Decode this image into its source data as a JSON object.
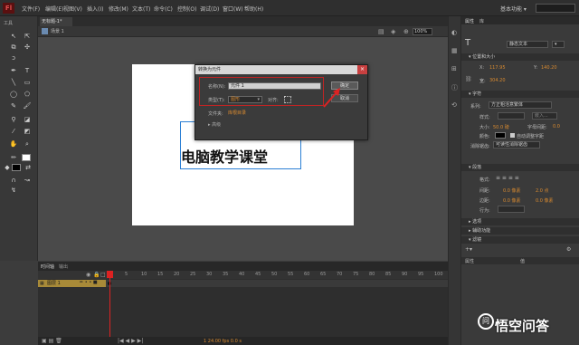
{
  "app": {
    "logo": "Fl"
  },
  "menu": [
    "文件(F)",
    "编辑(E)",
    "视图(V)",
    "插入(I)",
    "修改(M)",
    "文本(T)",
    "命令(C)",
    "控制(O)",
    "调试(D)",
    "窗口(W)",
    "帮助(H)"
  ],
  "workspace": {
    "label": "基本功能 ▾"
  },
  "document": {
    "tab": "无标题-1*",
    "close": "×",
    "scene": "场景 1",
    "zoom": "100%"
  },
  "tools": {
    "title": "工具"
  },
  "stage": {
    "text": "电脑教学课堂",
    "text_color": "#111111",
    "stage_color": "#ffffff"
  },
  "dialog": {
    "title": "转换为元件",
    "close": "×",
    "name_label": "名称(N):",
    "name_value": "元件 1",
    "type_label": "类型(T):",
    "type_value": "图形",
    "align_label": "对齐:",
    "folder_label": "文件夹:",
    "folder_value": "库根目录",
    "ok": "确定",
    "cancel": "取消",
    "advanced": "▸ 高级"
  },
  "timeline": {
    "tabs": [
      "时间轴",
      "输出"
    ],
    "frame_numbers": [
      "1",
      "5",
      "10",
      "15",
      "20",
      "25",
      "30",
      "35",
      "40",
      "45",
      "50",
      "55",
      "60",
      "65",
      "70",
      "75",
      "80",
      "85",
      "90",
      "95",
      "100"
    ],
    "layer_name": "图层 1",
    "footer": "1   24.00 fps   0.0 s"
  },
  "properties": {
    "tabs": [
      "属性",
      "库"
    ],
    "text_type": "静态文本",
    "text_orient": "▾",
    "position_section": "▾ 位置和大小",
    "x_label": "X:",
    "x_value": "117.95",
    "y_label": "Y:",
    "y_value": "140.20",
    "w_label": "宽:",
    "w_value": "304.20",
    "char_section": "▾ 字符",
    "family_label": "系列:",
    "family_value": "方正粗活意繁体",
    "style_label": "样式:",
    "embed": "嵌入...",
    "size_label": "大小:",
    "size_value": "50.0 磅",
    "spacing_label": "字母间距:",
    "spacing_value": "0.0",
    "color_label": "颜色:",
    "autokern": "自动调整字距",
    "aa_label": "消除锯齿:",
    "aa_value": "可读性消除锯齿",
    "para_section": "▾ 段落",
    "format_label": "格式:",
    "gap_label": "间距:",
    "gap_value1": "0.0 像素",
    "gap_value2": "2.0 点",
    "margin_label": "边距:",
    "margin_value1": "0.0 像素",
    "margin_value2": "0.0 像素",
    "behavior_label": "行为:",
    "options_section": "▸ 选项",
    "a11y_section": "▸ 辅助功能",
    "filter_section": "▾ 滤镜",
    "prop_col": "属性",
    "val_col": "值"
  },
  "watermark": {
    "icon": "问",
    "text": "悟空问答"
  },
  "colors": {
    "accent": "#d88a30",
    "selection": "#2b7fd4",
    "highlight_red": "#c02424",
    "layer_yellow": "#a88a38"
  }
}
